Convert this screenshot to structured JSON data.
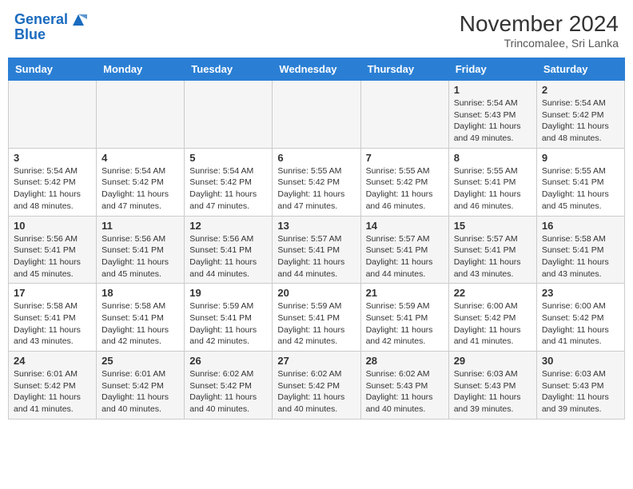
{
  "header": {
    "logo_line1": "General",
    "logo_line2": "Blue",
    "month_year": "November 2024",
    "location": "Trincomalee, Sri Lanka"
  },
  "weekdays": [
    "Sunday",
    "Monday",
    "Tuesday",
    "Wednesday",
    "Thursday",
    "Friday",
    "Saturday"
  ],
  "weeks": [
    [
      {
        "day": "",
        "info": ""
      },
      {
        "day": "",
        "info": ""
      },
      {
        "day": "",
        "info": ""
      },
      {
        "day": "",
        "info": ""
      },
      {
        "day": "",
        "info": ""
      },
      {
        "day": "1",
        "info": "Sunrise: 5:54 AM\nSunset: 5:43 PM\nDaylight: 11 hours\nand 49 minutes."
      },
      {
        "day": "2",
        "info": "Sunrise: 5:54 AM\nSunset: 5:42 PM\nDaylight: 11 hours\nand 48 minutes."
      }
    ],
    [
      {
        "day": "3",
        "info": "Sunrise: 5:54 AM\nSunset: 5:42 PM\nDaylight: 11 hours\nand 48 minutes."
      },
      {
        "day": "4",
        "info": "Sunrise: 5:54 AM\nSunset: 5:42 PM\nDaylight: 11 hours\nand 47 minutes."
      },
      {
        "day": "5",
        "info": "Sunrise: 5:54 AM\nSunset: 5:42 PM\nDaylight: 11 hours\nand 47 minutes."
      },
      {
        "day": "6",
        "info": "Sunrise: 5:55 AM\nSunset: 5:42 PM\nDaylight: 11 hours\nand 47 minutes."
      },
      {
        "day": "7",
        "info": "Sunrise: 5:55 AM\nSunset: 5:42 PM\nDaylight: 11 hours\nand 46 minutes."
      },
      {
        "day": "8",
        "info": "Sunrise: 5:55 AM\nSunset: 5:41 PM\nDaylight: 11 hours\nand 46 minutes."
      },
      {
        "day": "9",
        "info": "Sunrise: 5:55 AM\nSunset: 5:41 PM\nDaylight: 11 hours\nand 45 minutes."
      }
    ],
    [
      {
        "day": "10",
        "info": "Sunrise: 5:56 AM\nSunset: 5:41 PM\nDaylight: 11 hours\nand 45 minutes."
      },
      {
        "day": "11",
        "info": "Sunrise: 5:56 AM\nSunset: 5:41 PM\nDaylight: 11 hours\nand 45 minutes."
      },
      {
        "day": "12",
        "info": "Sunrise: 5:56 AM\nSunset: 5:41 PM\nDaylight: 11 hours\nand 44 minutes."
      },
      {
        "day": "13",
        "info": "Sunrise: 5:57 AM\nSunset: 5:41 PM\nDaylight: 11 hours\nand 44 minutes."
      },
      {
        "day": "14",
        "info": "Sunrise: 5:57 AM\nSunset: 5:41 PM\nDaylight: 11 hours\nand 44 minutes."
      },
      {
        "day": "15",
        "info": "Sunrise: 5:57 AM\nSunset: 5:41 PM\nDaylight: 11 hours\nand 43 minutes."
      },
      {
        "day": "16",
        "info": "Sunrise: 5:58 AM\nSunset: 5:41 PM\nDaylight: 11 hours\nand 43 minutes."
      }
    ],
    [
      {
        "day": "17",
        "info": "Sunrise: 5:58 AM\nSunset: 5:41 PM\nDaylight: 11 hours\nand 43 minutes."
      },
      {
        "day": "18",
        "info": "Sunrise: 5:58 AM\nSunset: 5:41 PM\nDaylight: 11 hours\nand 42 minutes."
      },
      {
        "day": "19",
        "info": "Sunrise: 5:59 AM\nSunset: 5:41 PM\nDaylight: 11 hours\nand 42 minutes."
      },
      {
        "day": "20",
        "info": "Sunrise: 5:59 AM\nSunset: 5:41 PM\nDaylight: 11 hours\nand 42 minutes."
      },
      {
        "day": "21",
        "info": "Sunrise: 5:59 AM\nSunset: 5:41 PM\nDaylight: 11 hours\nand 42 minutes."
      },
      {
        "day": "22",
        "info": "Sunrise: 6:00 AM\nSunset: 5:42 PM\nDaylight: 11 hours\nand 41 minutes."
      },
      {
        "day": "23",
        "info": "Sunrise: 6:00 AM\nSunset: 5:42 PM\nDaylight: 11 hours\nand 41 minutes."
      }
    ],
    [
      {
        "day": "24",
        "info": "Sunrise: 6:01 AM\nSunset: 5:42 PM\nDaylight: 11 hours\nand 41 minutes."
      },
      {
        "day": "25",
        "info": "Sunrise: 6:01 AM\nSunset: 5:42 PM\nDaylight: 11 hours\nand 40 minutes."
      },
      {
        "day": "26",
        "info": "Sunrise: 6:02 AM\nSunset: 5:42 PM\nDaylight: 11 hours\nand 40 minutes."
      },
      {
        "day": "27",
        "info": "Sunrise: 6:02 AM\nSunset: 5:42 PM\nDaylight: 11 hours\nand 40 minutes."
      },
      {
        "day": "28",
        "info": "Sunrise: 6:02 AM\nSunset: 5:43 PM\nDaylight: 11 hours\nand 40 minutes."
      },
      {
        "day": "29",
        "info": "Sunrise: 6:03 AM\nSunset: 5:43 PM\nDaylight: 11 hours\nand 39 minutes."
      },
      {
        "day": "30",
        "info": "Sunrise: 6:03 AM\nSunset: 5:43 PM\nDaylight: 11 hours\nand 39 minutes."
      }
    ]
  ]
}
